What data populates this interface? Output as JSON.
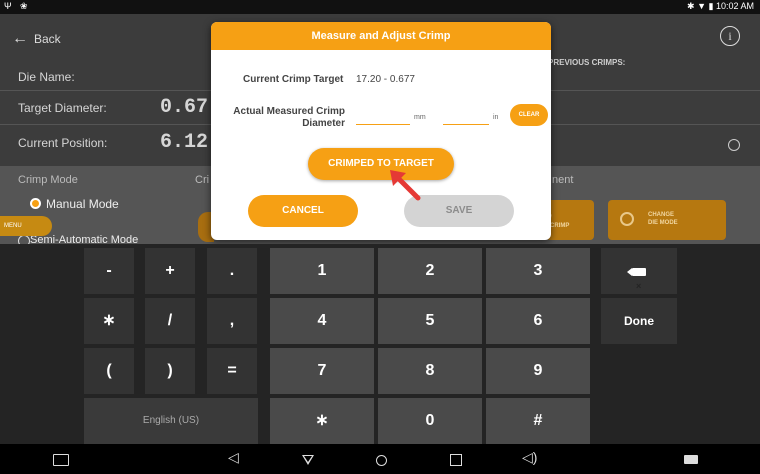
{
  "status_bar": {
    "left_icons": "Ψ ❀",
    "time": "10:02 AM"
  },
  "app": {
    "back_label": "Back",
    "die_name_label": "Die Name:",
    "target_diameter_label": "Target Diameter:",
    "target_diameter_value": "0.67",
    "current_position_label": "Current Position:",
    "current_position_value": "6.12",
    "previous_crimps_label": "PREVIOUS CRIMPS:",
    "crimp_mode_title": "Crimp Mode",
    "cri_partial": "Cri",
    "nent_partial": "nent",
    "manual_mode_label": "Manual Mode",
    "semi_auto_label": "Semi-Automatic Mode",
    "menu_label": "MENU",
    "crimp_button_label": "/ \nCRIMP",
    "change_die_mode_label": "CHANGE\nDIE MODE"
  },
  "dialog": {
    "title": "Measure and Adjust Crimp",
    "current_target_label": "Current Crimp Target",
    "current_target_value": "17.20  -  0.677",
    "actual_label": "Actual Measured Crimp Diameter",
    "mm_unit": "mm",
    "in_unit": "in",
    "clear_label": "CLEAR",
    "crimped_label": "CRIMPED TO TARGET",
    "cancel_label": "CANCEL",
    "save_label": "SAVE"
  },
  "keyboard": {
    "row1": [
      "-",
      "+",
      ".",
      "1",
      "2",
      "3"
    ],
    "row2": [
      "∗",
      "/",
      ",",
      "4",
      "5",
      "6"
    ],
    "row3": [
      "(",
      ")",
      "=",
      "7",
      "8",
      "9"
    ],
    "row4_space": "English (US)",
    "row4": [
      "∗",
      "0",
      "#"
    ],
    "done_label": "Done"
  },
  "colors": {
    "accent": "#f6a014",
    "disabled": "#d4d4d4",
    "arrow": "#e53935"
  }
}
